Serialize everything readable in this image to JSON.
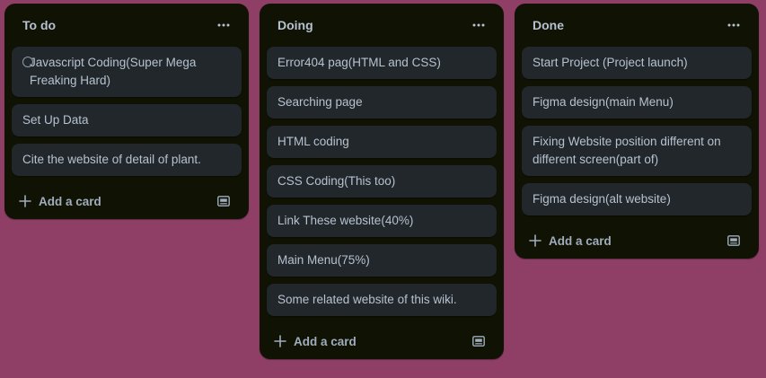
{
  "board": {
    "background_color": "#8f3f66",
    "add_card_label": "Add a card",
    "lists": [
      {
        "title": "To do",
        "cards": [
          "Javascript Coding(Super Mega Freaking Hard)",
          "Set Up Data",
          "Cite the website of detail of plant."
        ]
      },
      {
        "title": "Doing",
        "cards": [
          "Error404 pag(HTML and CSS)",
          "Searching page",
          "HTML coding",
          "CSS Coding(This too)",
          "Link These website(40%)",
          "Main Menu(75%)",
          "Some related website of this wiki."
        ]
      },
      {
        "title": "Done",
        "cards": [
          "Start Project (Project launch)",
          "Figma design(main Menu)",
          "Fixing Website position different on different screen(part of)",
          "Figma design(alt website)"
        ]
      }
    ]
  },
  "icons": {
    "list_menu": "more-horizontal-icon",
    "add": "plus-icon",
    "template": "card-template-icon",
    "checkbox": "circle-checkbox-icon"
  }
}
